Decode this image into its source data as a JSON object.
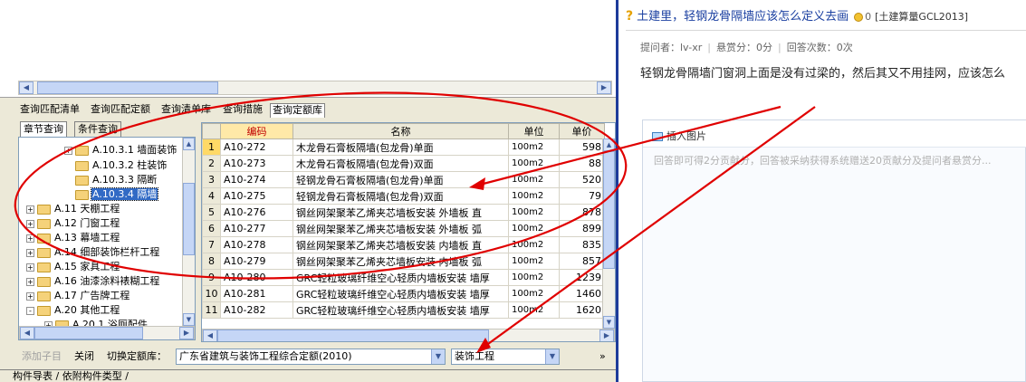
{
  "query_tabs": [
    "查询匹配清单",
    "查询匹配定额",
    "查询清单库",
    "查询措施",
    "查询定额库"
  ],
  "sub_tabs": [
    "章节查询",
    "条件查询"
  ],
  "tree": [
    {
      "label": "A.10.3.1 墙面装饰",
      "expander": "+",
      "selected": false
    },
    {
      "label": "A.10.3.2 柱装饰",
      "expander": "",
      "selected": false
    },
    {
      "label": "A.10.3.3 隔断",
      "expander": "",
      "selected": false
    },
    {
      "label": "A.10.3.4 隔墙",
      "expander": "",
      "selected": true
    },
    {
      "label": "A.11 天棚工程",
      "expander": "+",
      "selected": false
    },
    {
      "label": "A.12 门窗工程",
      "expander": "+",
      "selected": false
    },
    {
      "label": "A.13 幕墙工程",
      "expander": "+",
      "selected": false
    },
    {
      "label": "A.14 细部装饰栏杆工程",
      "expander": "+",
      "selected": false
    },
    {
      "label": "A.15 家具工程",
      "expander": "+",
      "selected": false
    },
    {
      "label": "A.16 油漆涂料裱糊工程",
      "expander": "+",
      "selected": false
    },
    {
      "label": "A.17 广告牌工程",
      "expander": "+",
      "selected": false
    },
    {
      "label": "A.20 其他工程",
      "expander": "-",
      "selected": false
    },
    {
      "label": "A.20.1 浴厕配件",
      "expander": "+",
      "selected": false
    }
  ],
  "grid": {
    "headers": [
      "",
      "编码",
      "名称",
      "单位",
      "单价"
    ],
    "rows": [
      {
        "n": "1",
        "code": "A10-272",
        "name": "木龙骨石膏板隔墙(包龙骨)单面",
        "unit": "100m2",
        "price": "598"
      },
      {
        "n": "2",
        "code": "A10-273",
        "name": "木龙骨石膏板隔墙(包龙骨)双面",
        "unit": "100m2",
        "price": "88"
      },
      {
        "n": "3",
        "code": "A10-274",
        "name": "轻钢龙骨石膏板隔墙(包龙骨)单面",
        "unit": "100m2",
        "price": "520"
      },
      {
        "n": "4",
        "code": "A10-275",
        "name": "轻钢龙骨石膏板隔墙(包龙骨)双面",
        "unit": "100m2",
        "price": "79"
      },
      {
        "n": "5",
        "code": "A10-276",
        "name": "钢丝网架聚苯乙烯夹芯墙板安装 外墙板 直",
        "unit": "100m2",
        "price": "878"
      },
      {
        "n": "6",
        "code": "A10-277",
        "name": "钢丝网架聚苯乙烯夹芯墙板安装 外墙板 弧",
        "unit": "100m2",
        "price": "899"
      },
      {
        "n": "7",
        "code": "A10-278",
        "name": "钢丝网架聚苯乙烯夹芯墙板安装 内墙板 直",
        "unit": "100m2",
        "price": "835"
      },
      {
        "n": "8",
        "code": "A10-279",
        "name": "钢丝网架聚苯乙烯夹芯墙板安装 内墙板 弧",
        "unit": "100m2",
        "price": "857"
      },
      {
        "n": "9",
        "code": "A10-280",
        "name": "GRC轻粒玻璃纤维空心轻质内墙板安装 墙厚",
        "unit": "100m2",
        "price": "1239"
      },
      {
        "n": "10",
        "code": "A10-281",
        "name": "GRC轻粒玻璃纤维空心轻质内墙板安装 墙厚",
        "unit": "100m2",
        "price": "1460"
      },
      {
        "n": "11",
        "code": "A10-282",
        "name": "GRC轻粒玻璃纤维空心轻质内墙板安装 墙厚",
        "unit": "100m2",
        "price": "1620"
      }
    ]
  },
  "bottom": {
    "add_child": "添加子目",
    "close": "关闭",
    "switch_label": "切换定额库：",
    "library": "广东省建筑与装饰工程综合定额(2010)",
    "profession": "装饰工程",
    "more": "»"
  },
  "bottom_tabs": "构件导表 / 依附构件类型 /",
  "question": {
    "title": "土建里，轻钢龙骨隔墙应该怎么定义去画",
    "score": "0",
    "category": "[土建算量GCL2013]",
    "asker": "提问者：lv-xr",
    "reward": "悬赏分：0分",
    "answers": "回答次数：0次",
    "body": "轻钢龙骨隔墙门窗洞上面是没有过梁的，然后其又不用挂网，应该怎么"
  },
  "answer": {
    "insert_image": "插入图片",
    "hint": "回答即可得2分贡献分，回答被采纳获得系统赠送20贡献分及提问者悬赏分..."
  },
  "colors": {
    "annotation": "#e00000",
    "selection": "#316ac5",
    "title_link": "#1a3fa0",
    "divider": "#1d3b9a"
  }
}
